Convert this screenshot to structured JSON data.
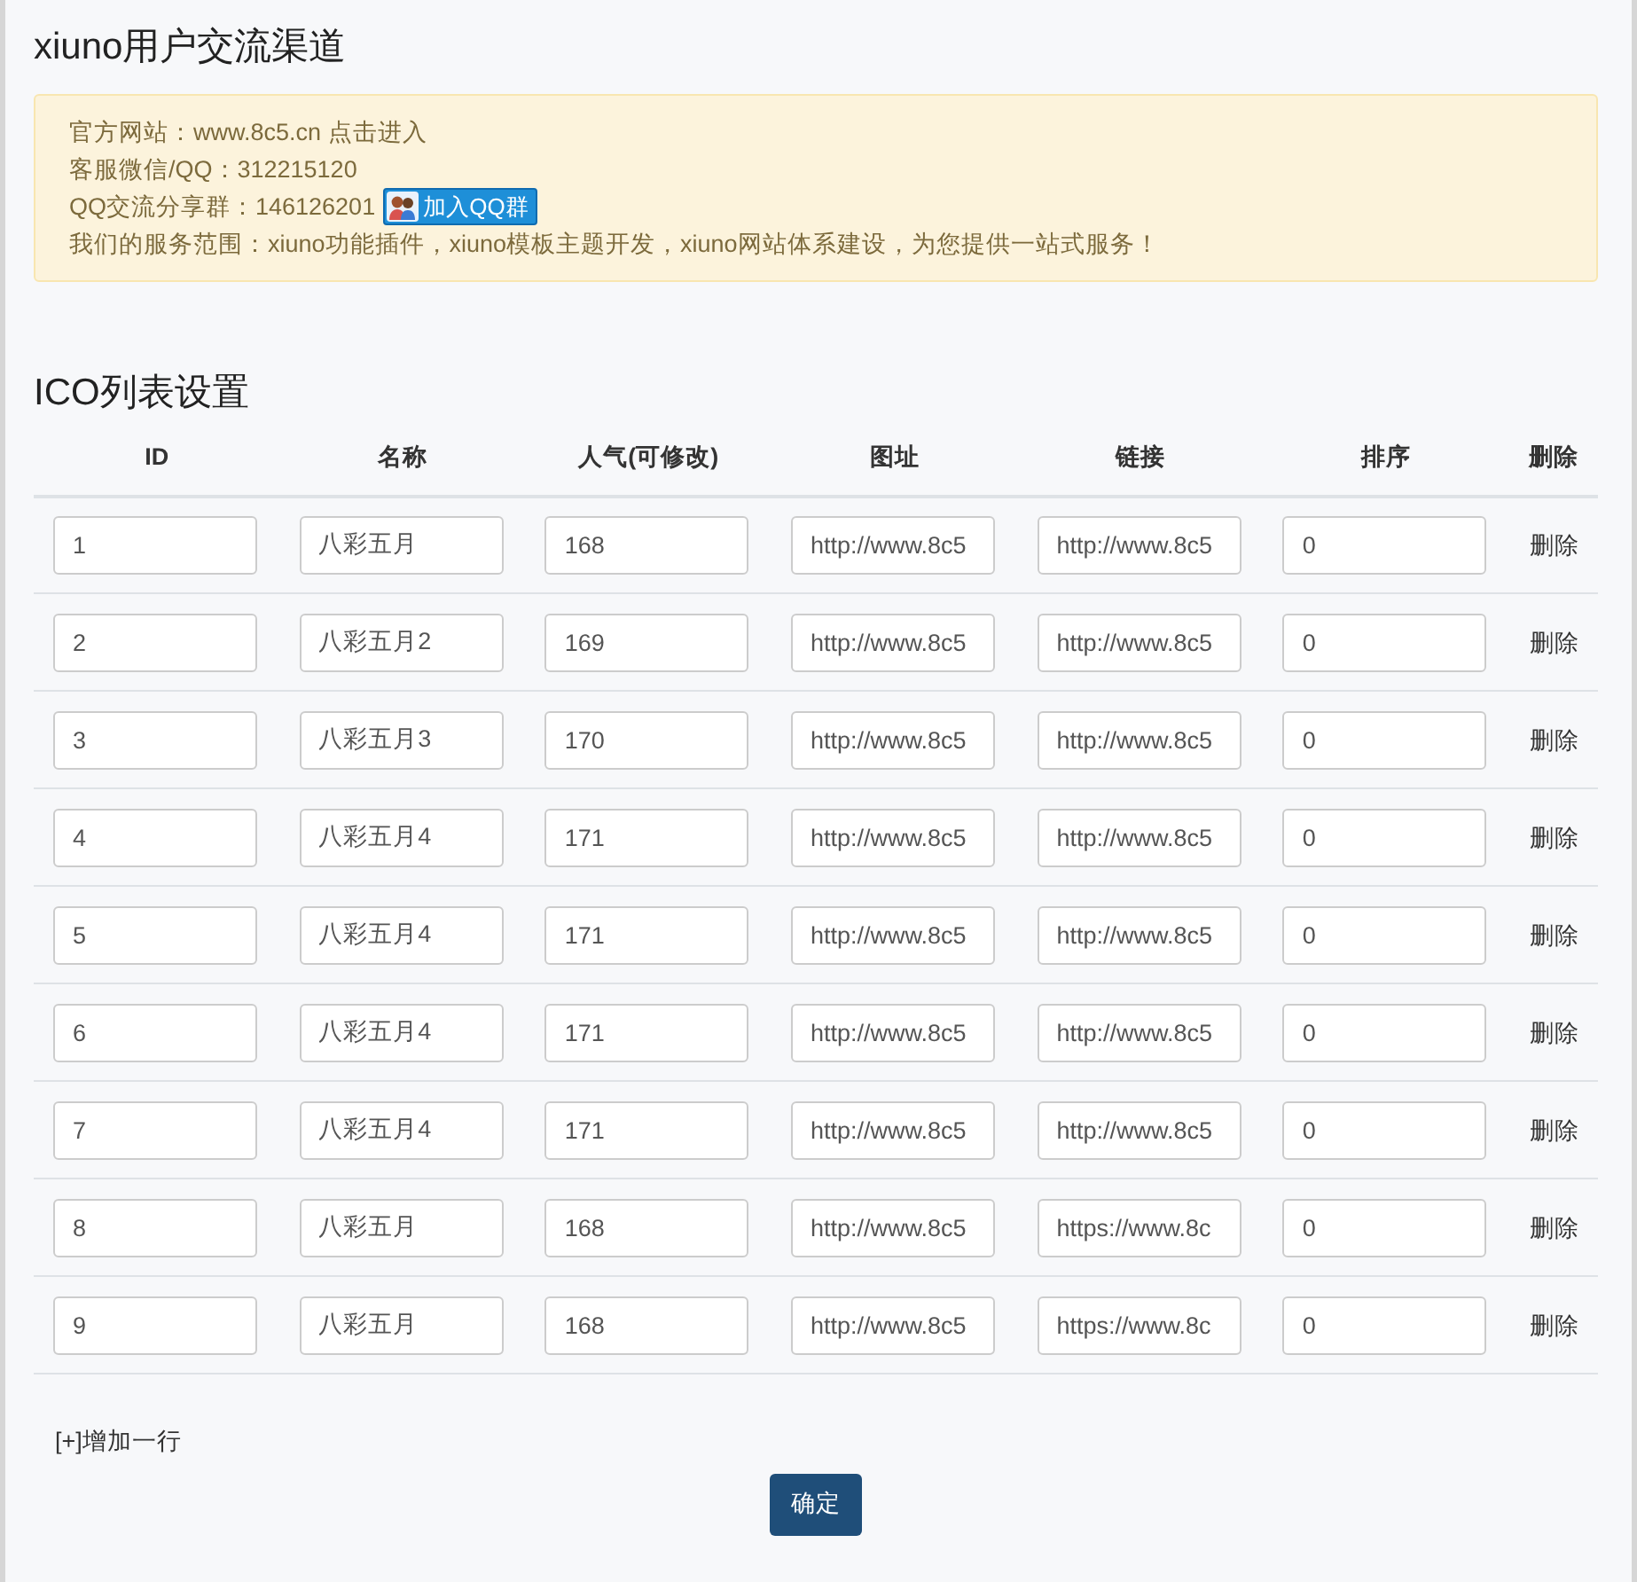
{
  "title": "xiuno用户交流渠道",
  "notice": {
    "lines": [
      {
        "kind": "link",
        "label": "官方网站：",
        "link": "www.8c5.cn 点击进入"
      },
      {
        "kind": "text",
        "label": "客服微信/QQ：312215120"
      },
      {
        "kind": "qq",
        "label": "QQ交流分享群：146126201",
        "button": "加入QQ群"
      },
      {
        "kind": "text",
        "label": "我们的服务范围：xiuno功能插件，xiuno模板主题开发，xiuno网站体系建设，为您提供一站式服务！"
      }
    ]
  },
  "section_title": "ICO列表设置",
  "table": {
    "columns": [
      "ID",
      "名称",
      "人气(可修改)",
      "图址",
      "链接",
      "排序",
      "删除"
    ],
    "rows": [
      {
        "cells": [
          "1",
          "八彩五月",
          "168",
          "http://www.8c5",
          "http://www.8c5",
          "0"
        ],
        "action": "删除"
      },
      {
        "cells": [
          "2",
          "八彩五月2",
          "169",
          "http://www.8c5",
          "http://www.8c5",
          "0"
        ],
        "action": "删除"
      },
      {
        "cells": [
          "3",
          "八彩五月3",
          "170",
          "http://www.8c5",
          "http://www.8c5",
          "0"
        ],
        "action": "删除"
      },
      {
        "cells": [
          "4",
          "八彩五月4",
          "171",
          "http://www.8c5",
          "http://www.8c5",
          "0"
        ],
        "action": "删除"
      },
      {
        "cells": [
          "5",
          "八彩五月4",
          "171",
          "http://www.8c5",
          "http://www.8c5",
          "0"
        ],
        "action": "删除"
      },
      {
        "cells": [
          "6",
          "八彩五月4",
          "171",
          "http://www.8c5",
          "http://www.8c5",
          "0"
        ],
        "action": "删除"
      },
      {
        "cells": [
          "7",
          "八彩五月4",
          "171",
          "http://www.8c5",
          "http://www.8c5",
          "0"
        ],
        "action": "删除"
      },
      {
        "cells": [
          "8",
          "八彩五月",
          "168",
          "http://www.8c5",
          "https://www.8c",
          "0"
        ],
        "action": "删除"
      },
      {
        "cells": [
          "9",
          "八彩五月",
          "168",
          "http://www.8c5",
          "https://www.8c",
          "0"
        ],
        "action": "删除"
      }
    ]
  },
  "add_row": "[+]增加一行",
  "submit": "确定"
}
